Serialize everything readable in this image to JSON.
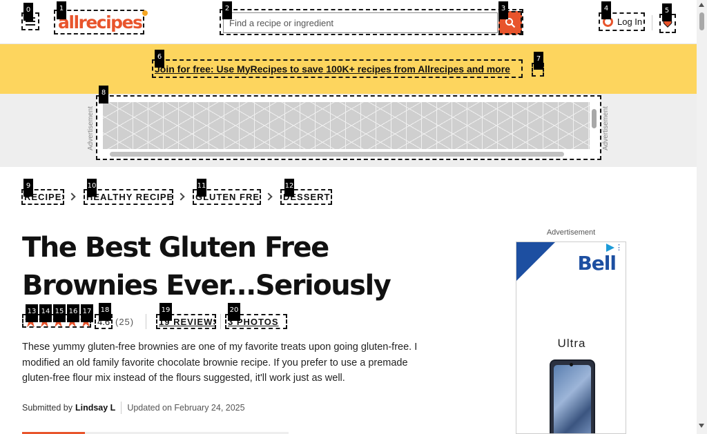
{
  "header": {
    "logo_text": "allrecipes",
    "search_placeholder": "Find a recipe or ingredient",
    "login_label": "Log In"
  },
  "promo": {
    "link_text": "Join for free: Use MyRecipes to save 100K+ recipes from Allrecipes and more"
  },
  "ad_banner": {
    "label": "Advertisement"
  },
  "breadcrumbs": [
    "RECIPES",
    "HEALTHY RECIPES",
    "GLUTEN FREE",
    "DESSERTS"
  ],
  "recipe": {
    "title": "The Best Gluten Free Brownies Ever...Seriously",
    "rating_value": "4.6",
    "rating_stars": 4.5,
    "rating_count": "(25)",
    "reviews_label": "19 REVIEWS",
    "photos_label": "3 PHOTOS",
    "description": "These yummy gluten-free brownies are one of my favorite treats upon going gluten-free. I modified an old family favorite chocolate brownie recipe. If you prefer to use a premade gluten-free flour mix instead of the flours suggested, it'll work just as well.",
    "submitted_by_prefix": "Submitted by",
    "author": "Lindsay L",
    "updated": "Updated on February 24, 2025"
  },
  "side_ad": {
    "label": "Advertisement",
    "brand": "Bell",
    "product": "Ultra"
  },
  "markers": [
    "0",
    "1",
    "2",
    "3",
    "4",
    "5",
    "6",
    "7",
    "8",
    "9",
    "10",
    "11",
    "12",
    "13",
    "14",
    "15",
    "16",
    "17",
    "18",
    "19",
    "20"
  ],
  "colors": {
    "brand_orange": "#e8542c",
    "promo_yellow": "#fdd55e",
    "bell_blue": "#1d4fa1"
  }
}
